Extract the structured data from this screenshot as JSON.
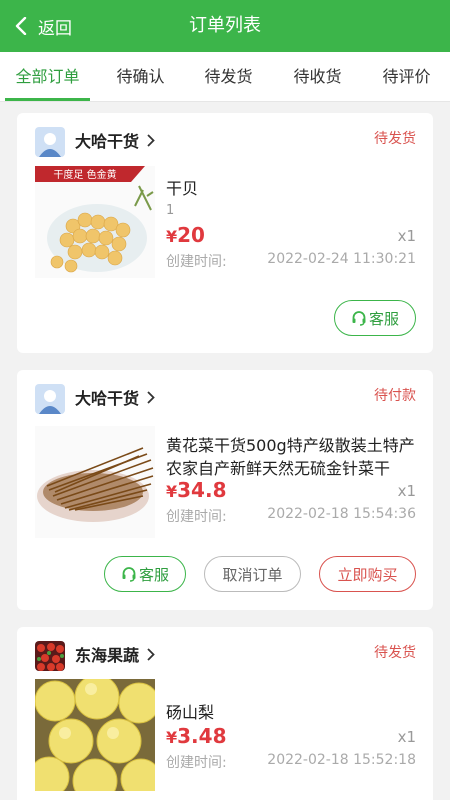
{
  "header": {
    "back_label": "返回",
    "title": "订单列表"
  },
  "tabs": [
    "全部订单",
    "待确认",
    "待发货",
    "待收货",
    "待评价"
  ],
  "active_tab": 0,
  "orders": [
    {
      "store": "大哈干货",
      "status": "待发货",
      "product_title": "干贝",
      "spec": "1",
      "currency": "¥",
      "price": "20",
      "qty": "x1",
      "created_label": "创建时间:",
      "created_time": "2022-02-24 11:30:21",
      "thumb_banner": "干度足 色金黄",
      "buttons": {
        "service": "客服"
      }
    },
    {
      "store": "大哈干货",
      "status": "待付款",
      "product_title": "黄花菜干货500g特产级散装土特产农家自产新鲜天然无硫金针菜干",
      "currency": "¥",
      "price": "34.8",
      "qty": "x1",
      "created_label": "创建时间:",
      "created_time": "2022-02-18 15:54:36",
      "buttons": {
        "service": "客服",
        "cancel": "取消订单",
        "buy": "立即购买"
      }
    },
    {
      "store": "东海果蔬",
      "status": "待发货",
      "product_title": "砀山梨",
      "currency": "¥",
      "price": "3.48",
      "qty": "x1",
      "created_label": "创建时间:",
      "created_time": "2022-02-18 15:52:18"
    }
  ],
  "colors": {
    "brand_green": "#3cb54a",
    "status_red": "#d9534f",
    "price_red": "#e0393e"
  },
  "icons": {
    "back": "chevron-left-icon",
    "store_arrow": "chevron-right-icon",
    "service": "headset-icon"
  }
}
